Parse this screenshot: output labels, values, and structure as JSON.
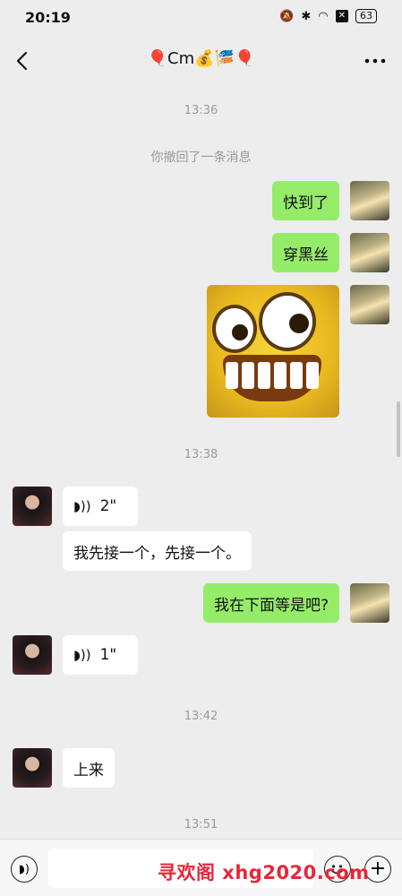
{
  "status_bar": {
    "time": "20:19",
    "battery": "63"
  },
  "nav": {
    "title": "🎈Cm💰🎏🎈"
  },
  "messages": {
    "time_1": "13:36",
    "recalled": "你撤回了一条消息",
    "sent_1": "快到了",
    "sent_2": "穿黑丝",
    "time_2": "13:38",
    "voice_1_duration": "2\"",
    "recv_1": "我先接一个，先接一个。",
    "sent_3": "我在下面等是吧?",
    "voice_2_duration": "1\"",
    "time_3": "13:42",
    "recv_2": "上来",
    "time_4": "13:51"
  },
  "icons": {
    "voice_icon": "voice-wave-icon",
    "back": "chevron-left-icon",
    "more": "more-dots-icon",
    "emoji": "emoji-icon",
    "plus": "plus-icon"
  },
  "watermark": "寻欢阁 xhg2020.com",
  "colors": {
    "sent_bubble": "#95ec69",
    "recv_bubble": "#ffffff",
    "background": "#ededed",
    "watermark": "#e8273a"
  }
}
